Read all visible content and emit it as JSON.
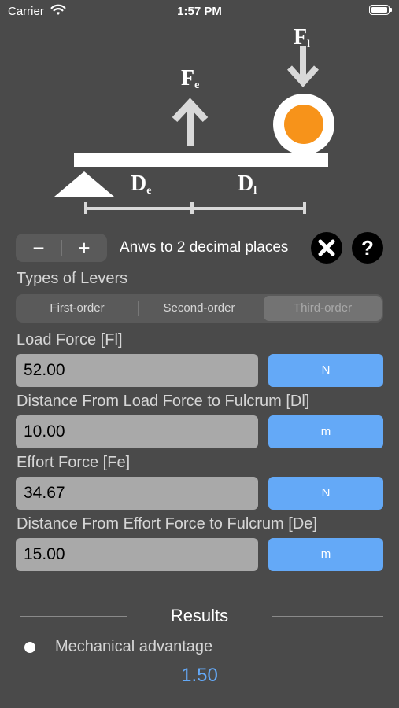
{
  "status_bar": {
    "carrier": "Carrier",
    "time": "1:57 PM",
    "icons": [
      "wifi-icon",
      "battery-icon"
    ]
  },
  "diagram": {
    "load_force_label": "F",
    "load_force_sub": "l",
    "effort_force_label": "F",
    "effort_force_sub": "e",
    "effort_distance_label": "D",
    "effort_distance_sub": "e",
    "load_distance_label": "D",
    "load_distance_sub": "l",
    "load_color": "#f7931a"
  },
  "controls": {
    "decrement_label": "−",
    "increment_label": "+",
    "precision_text": "Anws to 2 decimal places",
    "clear_icon": "close-icon",
    "help_label": "?"
  },
  "lever_types": {
    "title": "Types of Levers",
    "options": [
      "First-order",
      "Second-order",
      "Third-order"
    ],
    "selected": "Third-order"
  },
  "inputs": [
    {
      "label": "Load Force [Fl]",
      "value": "52.00",
      "unit": "N"
    },
    {
      "label": "Distance From Load Force to Fulcrum [Dl]",
      "value": "10.00",
      "unit": "m"
    },
    {
      "label": "Effort Force [Fe]",
      "value": "34.67",
      "unit": "N"
    },
    {
      "label": "Distance From Effort Force to Fulcrum [De]",
      "value": "15.00",
      "unit": "m"
    }
  ],
  "results": {
    "title": "Results",
    "items": [
      {
        "label": "Mechanical advantage",
        "value": "1.50"
      }
    ]
  },
  "colors": {
    "background": "#4a4a4a",
    "accent": "#64a9f7",
    "field": "#a9a9a9"
  }
}
